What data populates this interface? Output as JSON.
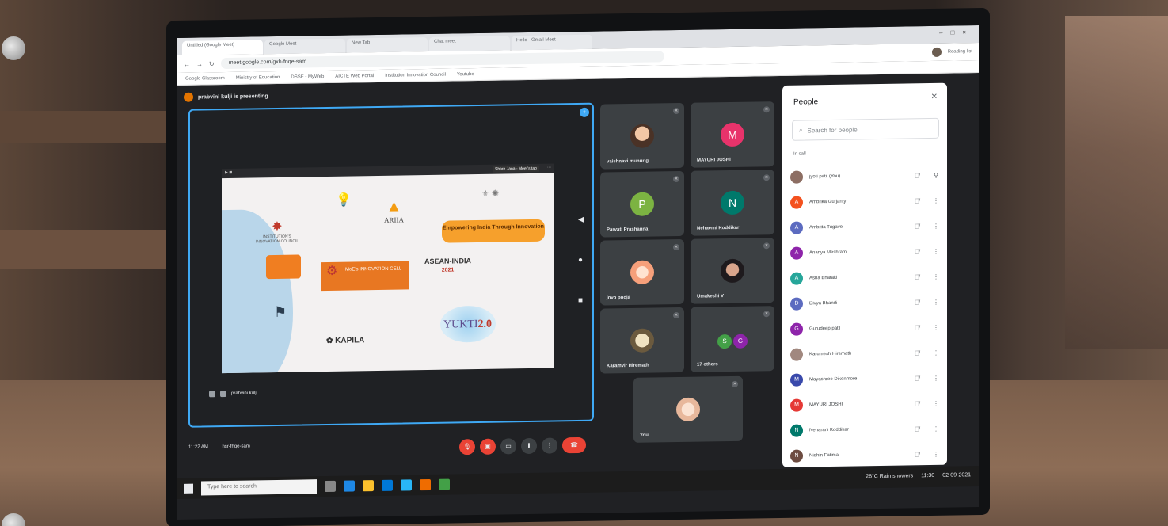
{
  "browser": {
    "tabs": [
      "Untitled (Google Meet)",
      "Google Meet",
      "New Tab",
      "Chat meet",
      "Hello - Gmail Meet"
    ],
    "url": "meet.google.com/gxh-fnqe-sam",
    "reading_list": "Reading list",
    "bookmarks": [
      "Google Classroom",
      "Ministry of Education",
      "DSSE - MyWeb",
      "AICTE Web Portal",
      "Institution Innovation Council",
      "Youtube"
    ]
  },
  "meet": {
    "presenting": "prabvini kulji is presenting",
    "stage_name": "prabvini kulji",
    "time": "11:22 AM",
    "meeting_code": "hsr-fhqe-sam",
    "slide": {
      "tooltip": "Share Jana - Meet's tab",
      "iic": "INSTITUTION'S INNOVATION COUNCIL",
      "ariia": "ARIIA",
      "empowering": "Empowering India Through Innovation",
      "innovation": "MoE's INNOVATION CELL",
      "asean": "ASEAN-INDIA",
      "asean_year": "2021",
      "kapila": "KAPILA",
      "yukti": "YUKTI",
      "yukti_ver": "2.0"
    },
    "tiles": [
      {
        "name": "vaishnavi munurig",
        "initial": "",
        "color": ""
      },
      {
        "name": "MAYURI JOSHI",
        "initial": "M",
        "color": "#e8336b"
      },
      {
        "name": "Parvati Prashanna",
        "initial": "P",
        "color": "#7cb342"
      },
      {
        "name": "Nehaerni Koddikar",
        "initial": "N",
        "color": "#00796b"
      },
      {
        "name": "jnvo pooja",
        "initial": "",
        "color": ""
      },
      {
        "name": "Umakeshi V",
        "initial": "",
        "color": ""
      },
      {
        "name": "Karamvir Hiremath",
        "initial": "",
        "color": ""
      },
      {
        "name": "17 others",
        "initial": "SG",
        "color": "#43a047"
      },
      {
        "name": "You",
        "initial": "",
        "color": ""
      }
    ],
    "controls": [
      "mic-off",
      "cam-off",
      "captions",
      "present",
      "more",
      "end-call"
    ]
  },
  "people": {
    "title": "People",
    "search_placeholder": "Search for people",
    "in_call": "In call",
    "list": [
      {
        "name": "jyoti patil (You)",
        "initial": "",
        "color": "#8d6e63"
      },
      {
        "name": "Ambrika Gurjanty",
        "initial": "A",
        "color": "#f4511e"
      },
      {
        "name": "Ambrita Tugave",
        "initial": "A",
        "color": "#5c6bc0"
      },
      {
        "name": "Ananya Meshram",
        "initial": "A",
        "color": "#8e24aa"
      },
      {
        "name": "Asha Bhatakl",
        "initial": "A",
        "color": "#26a69a"
      },
      {
        "name": "Divya Bhandi",
        "initial": "D",
        "color": "#5c6bc0"
      },
      {
        "name": "Gurudeep patil",
        "initial": "G",
        "color": "#8e24aa"
      },
      {
        "name": "Karumesh Hiremath",
        "initial": "",
        "color": "#a1887f"
      },
      {
        "name": "Mayashree Dikenmore",
        "initial": "M",
        "color": "#3949ab"
      },
      {
        "name": "MAYURI JOSHI",
        "initial": "M",
        "color": "#e53935"
      },
      {
        "name": "Neharani Koddikar",
        "initial": "N",
        "color": "#00796b"
      },
      {
        "name": "Nidhin Fatima",
        "initial": "N",
        "color": "#6d4c41"
      }
    ]
  },
  "taskbar": {
    "search": "Type here to search",
    "weather": "26°C Rain showers",
    "clock": "11:30",
    "date": "02-09-2021"
  }
}
